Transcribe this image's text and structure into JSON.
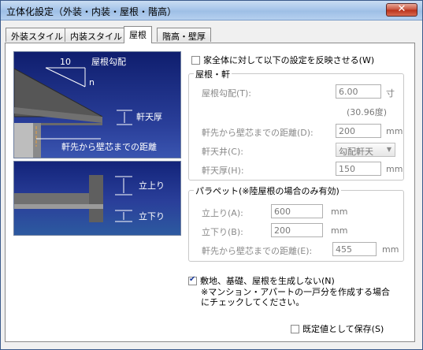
{
  "window": {
    "title": "立体化設定（外装・内装・屋根・階高）",
    "close_label": "✕"
  },
  "tabs": [
    {
      "label": "外装スタイル"
    },
    {
      "label": "内装スタイル"
    },
    {
      "label": "屋根",
      "active": true
    },
    {
      "label": "階高・壁厚"
    }
  ],
  "diagram_top": {
    "ten_label": "10",
    "pitch_label": "屋根勾配",
    "n_label": "n",
    "soffit_label": "軒天厚",
    "eave_dist_label": "軒先から壁芯までの距離"
  },
  "diagram_bottom": {
    "up_label": "立上り",
    "down_label": "立下り"
  },
  "apply_all": {
    "label": "家全体に対して以下の設定を反映させる(W)",
    "checked": false
  },
  "roof_eave": {
    "title": "屋根・軒",
    "pitch": {
      "label": "屋根勾配(T):",
      "value": "6.00",
      "unit": "寸",
      "degree": "(30.96度)"
    },
    "eave_distance": {
      "label": "軒先から壁芯までの距離(D):",
      "value": "200",
      "unit": "mm"
    },
    "soffit": {
      "label": "軒天井(C):",
      "value": "勾配軒天"
    },
    "soffit_thickness": {
      "label": "軒天厚(H):",
      "value": "150",
      "unit": "mm"
    }
  },
  "parapet": {
    "title": "パラペット(※陸屋根の場合のみ有効)",
    "rise": {
      "label": "立上り(A):",
      "value": "600",
      "unit": "mm"
    },
    "drop": {
      "label": "立下り(B):",
      "value": "200",
      "unit": "mm"
    },
    "eave_distance": {
      "label": "軒先から壁芯までの距離(E):",
      "value": "455",
      "unit": "mm"
    }
  },
  "no_site": {
    "label": "敷地、基礎、屋根を生成しない(N)",
    "checked": true,
    "note_line1": "※マンション・アパートの一戸分を作成する場合",
    "note_line2": "にチェックしてください。"
  },
  "save_default": {
    "label": "既定値として保存(S)",
    "checked": false
  },
  "colors": {
    "diagram_bg": "#1c2f86",
    "titlebar": "#a8c6ea"
  }
}
